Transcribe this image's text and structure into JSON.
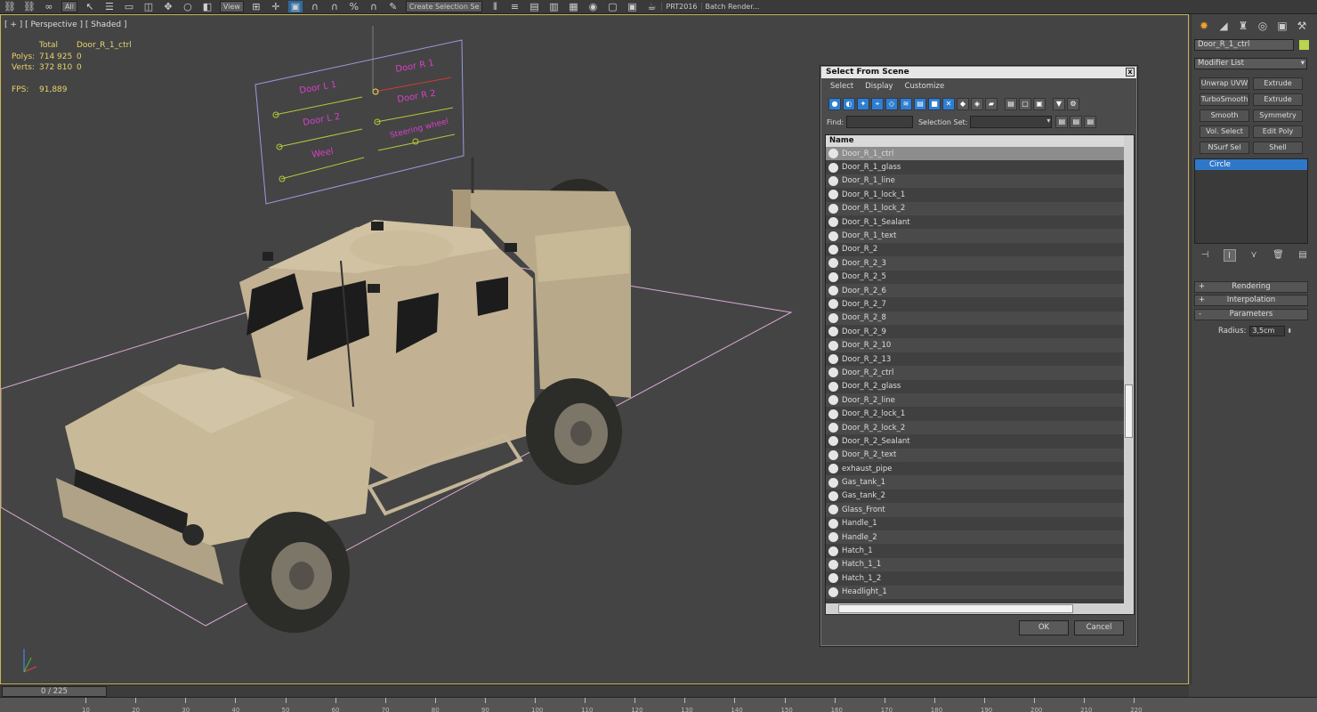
{
  "toolbar": {
    "combos": [
      "All",
      "View",
      "Create Selection Se"
    ],
    "labels": [
      "PRT2016",
      "Batch Render..."
    ]
  },
  "viewport": {
    "label": "[ + ] [ Perspective ] [ Shaded ]",
    "stats": {
      "total_label": "Total",
      "object_name": "Door_R_1_ctrl",
      "polys_label": "Polys:",
      "polys_total": "714 925",
      "polys_obj": "0",
      "verts_label": "Verts:",
      "verts_total": "372 810",
      "verts_obj": "0",
      "fps_label": "FPS:",
      "fps_value": "91,889"
    },
    "control_panel_labels": [
      "Door L 1",
      "Door R 1",
      "Door L 2",
      "Door R 2",
      "Weel",
      "Steering wheel"
    ]
  },
  "dialog": {
    "title": "Select From Scene",
    "close": "x",
    "menu": [
      "Select",
      "Display",
      "Customize"
    ],
    "find_label": "Find:",
    "selection_set_label": "Selection Set:",
    "column_name": "Name",
    "items": [
      "Door_R_1_ctrl",
      "Door_R_1_glass",
      "Door_R_1_line",
      "Door_R_1_lock_1",
      "Door_R_1_lock_2",
      "Door_R_1_Sealant",
      "Door_R_1_text",
      "Door_R_2",
      "Door_R_2_3",
      "Door_R_2_5",
      "Door_R_2_6",
      "Door_R_2_7",
      "Door_R_2_8",
      "Door_R_2_9",
      "Door_R_2_10",
      "Door_R_2_13",
      "Door_R_2_ctrl",
      "Door_R_2_glass",
      "Door_R_2_line",
      "Door_R_2_lock_1",
      "Door_R_2_lock_2",
      "Door_R_2_Sealant",
      "Door_R_2_text",
      "exhaust_pipe",
      "Gas_tank_1",
      "Gas_tank_2",
      "Glass_Front",
      "Handle_1",
      "Handle_2",
      "Hatch_1",
      "Hatch_1_1",
      "Hatch_1_2",
      "Headlight_1"
    ],
    "ok": "OK",
    "cancel": "Cancel"
  },
  "command_panel": {
    "object_name": "Door_R_1_ctrl",
    "modifier_list": "Modifier List",
    "modifier_buttons": [
      "Unwrap UVW",
      "Extrude",
      "TurboSmooth",
      "Extrude",
      "Smooth",
      "Symmetry",
      "Vol. Select",
      "Edit Poly",
      "NSurf Sel",
      "Shell"
    ],
    "stack_item": "Circle",
    "rollouts": [
      {
        "sign": "+",
        "label": "Rendering"
      },
      {
        "sign": "+",
        "label": "Interpolation"
      },
      {
        "sign": "-",
        "label": "Parameters"
      }
    ],
    "radius_label": "Radius:",
    "radius_value": "3,5cm"
  },
  "timeline": {
    "frame": "0 / 225",
    "ticks": [
      "10",
      "20",
      "30",
      "40",
      "50",
      "60",
      "70",
      "80",
      "90",
      "100",
      "110",
      "120",
      "130",
      "140",
      "150",
      "160",
      "170",
      "180",
      "190",
      "200",
      "210",
      "220"
    ]
  }
}
